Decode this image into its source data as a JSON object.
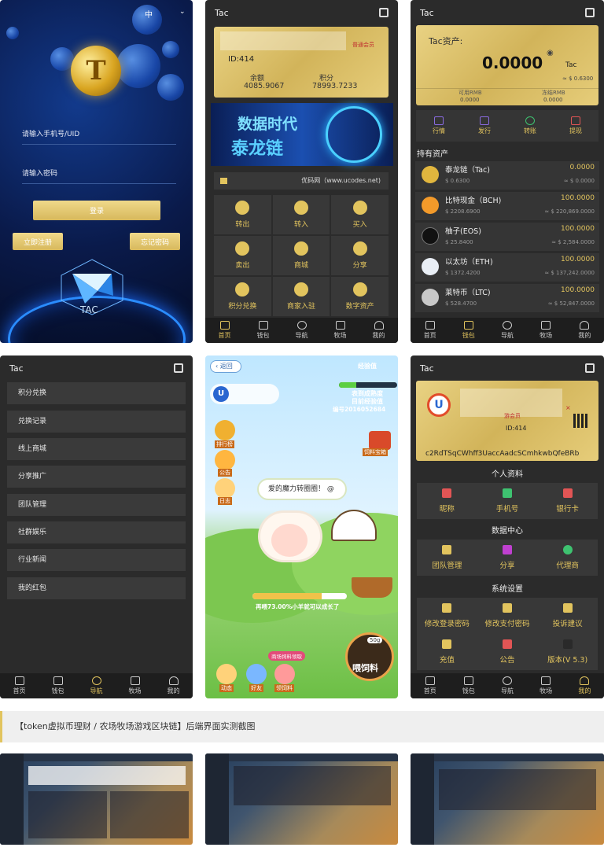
{
  "login": {
    "lang": "中",
    "lang_arrow": "⌄",
    "phone_placeholder": "请输入手机号/UID",
    "password_placeholder": "请输入密码",
    "login_btn": "登录",
    "register_btn": "立即注册",
    "forgot_btn": "忘记密码",
    "logo_letter": "T",
    "brand": "TAC"
  },
  "wallet": {
    "title": "Tac",
    "card_id": "ID:414",
    "card_tag": "普通会员",
    "balance_label": "余额",
    "balance_value": "4085.9067",
    "points_label": "积分",
    "points_value": "78993.7233",
    "banner_line1": "数据时代",
    "banner_line2": "泰龙链",
    "notice": "优码网（www.ucodes.net)",
    "actions": [
      "转出",
      "转入",
      "买入",
      "卖出",
      "商城",
      "分享",
      "积分兑换",
      "商家入驻",
      "数字资产"
    ]
  },
  "assets": {
    "title": "Tac",
    "card_label": "Tac资产:",
    "card_total": "0.0000",
    "card_coin": "Tac",
    "card_rmb": "≈ $ 0.6300",
    "avail_label": "可用RMB",
    "avail_value": "0.0000",
    "frozen_label": "冻结RMB",
    "frozen_value": "0.0000",
    "quick": [
      "行情",
      "发行",
      "转账",
      "提现"
    ],
    "section": "持有资产",
    "rows": [
      {
        "name": "泰龙链（Tac)",
        "price": "$ 0.6300",
        "amount": "0.0000",
        "rmb": "≈ $ 0.0000",
        "color": "#e1b63e"
      },
      {
        "name": "比特现金（BCH)",
        "price": "$ 2208.6900",
        "amount": "100.0000",
        "rmb": "≈ $ 220,869.0000",
        "color": "#f39a2a"
      },
      {
        "name": "柚子(EOS)",
        "price": "$ 25.8400",
        "amount": "100.0000",
        "rmb": "≈ $ 2,584.0000",
        "color": "#111111"
      },
      {
        "name": "以太坊（ETH)",
        "price": "$ 1372.4200",
        "amount": "100.0000",
        "rmb": "≈ $ 137,242.0000",
        "color": "#e9eef5"
      },
      {
        "name": "莱特币（LTC)",
        "price": "$ 528.4700",
        "amount": "100.0000",
        "rmb": "≈ $ 52,847.0000",
        "color": "#c8c8c8"
      }
    ]
  },
  "nav": [
    "首页",
    "钱包",
    "导航",
    "牧场",
    "我的"
  ],
  "menu": {
    "title": "Tac",
    "items": [
      "积分兑换",
      "兑换记录",
      "线上商城",
      "分享推广",
      "团队管理",
      "社群娱乐",
      "行业新闻",
      "我的红包"
    ]
  },
  "farm": {
    "back": "返回",
    "level_label": "经验值",
    "stat1": "表到成熟度",
    "stat2": "目前经验值",
    "code": "编号2016052684",
    "rank": "排行榜",
    "notice": "公告",
    "log": "日志",
    "box": "饲料宝箱",
    "bubble": "爱的魔力转圈圈！",
    "bubble_icon": "@",
    "progress_text": "再喂73.00%小羊就可以成长了",
    "progress": 0.73,
    "feed_tag": "商场饲料领取",
    "feed_amount": "50g",
    "feed_btn": "喂饲料",
    "dyn": "动态",
    "friends": "好友",
    "get_feed": "领饲料"
  },
  "profile": {
    "title": "Tac",
    "id": "ID:414",
    "tag": "游会员",
    "address": "c2RdTSqCWhff3UaccAadcSCmhkwbQfeBRb",
    "personal": "个人资料",
    "personal_items": [
      "昵称",
      "手机号",
      "银行卡"
    ],
    "data_center": "数据中心",
    "data_items": [
      "团队管理",
      "分享",
      "代理商"
    ],
    "system": "系统设置",
    "system_items": [
      "修改登录密码",
      "修改支付密码",
      "投诉建议",
      "充值",
      "公告",
      "版本(V 5.3)"
    ]
  },
  "caption": "【token虚拟币理财 / 农场牧场游戏区块链】后端界面实测截图"
}
